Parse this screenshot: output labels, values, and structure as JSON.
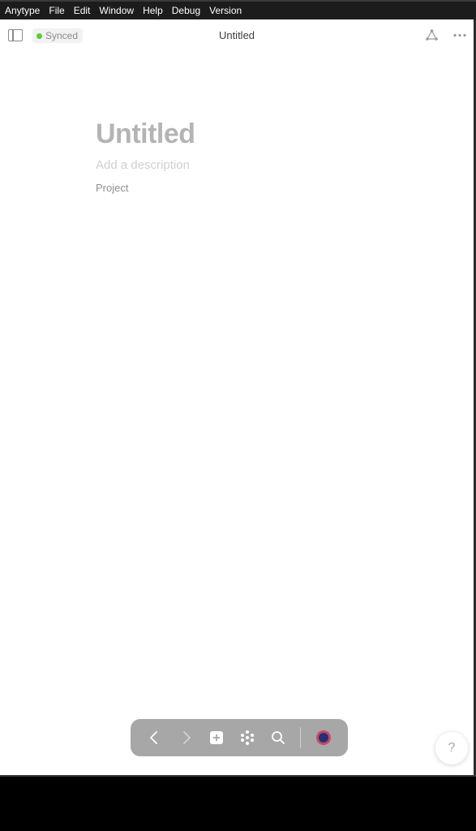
{
  "menubar": {
    "items": [
      "Anytype",
      "File",
      "Edit",
      "Window",
      "Help",
      "Debug",
      "Version"
    ]
  },
  "header": {
    "sync_status": "Synced",
    "title": "Untitled"
  },
  "page": {
    "title": "Untitled",
    "description_placeholder": "Add a description",
    "type": "Project"
  },
  "navbar": {
    "icons": [
      "back-icon",
      "forward-icon",
      "plus-icon",
      "graph-dots-icon",
      "search-icon",
      "account-avatar"
    ]
  },
  "help": {
    "label": "?"
  },
  "colors": {
    "sync_dot": "#5dcb3a",
    "navbar_bg": "#a7a7a7",
    "avatar_ring": "#c24a6a",
    "avatar_center": "#2a2f6e"
  }
}
